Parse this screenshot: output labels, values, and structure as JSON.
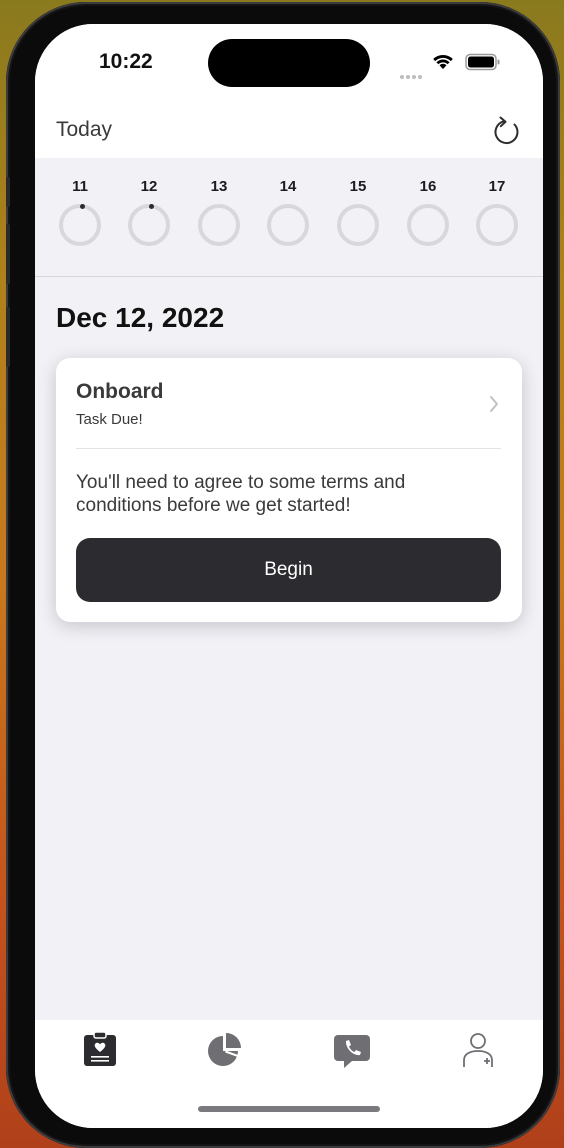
{
  "status_bar": {
    "time": "10:22"
  },
  "nav": {
    "title": "Today"
  },
  "week": {
    "days": [
      {
        "label": "11",
        "has_event": true
      },
      {
        "label": "12",
        "has_event": true
      },
      {
        "label": "13",
        "has_event": false
      },
      {
        "label": "14",
        "has_event": false
      },
      {
        "label": "15",
        "has_event": false
      },
      {
        "label": "16",
        "has_event": false
      },
      {
        "label": "17",
        "has_event": false
      }
    ]
  },
  "date_heading": "Dec 12, 2022",
  "task_card": {
    "title": "Onboard",
    "subtitle": "Task Due!",
    "body": "You'll need to agree to some terms and conditions before we get started!",
    "button_label": "Begin"
  },
  "tab_bar": {
    "tabs": [
      {
        "icon": "clipboard-heart-icon",
        "selected": true
      },
      {
        "icon": "pie-chart-icon",
        "selected": false
      },
      {
        "icon": "phone-bubble-icon",
        "selected": false
      },
      {
        "icon": "person-add-icon",
        "selected": false
      }
    ]
  },
  "colors": {
    "accent_dark": "#2c2c30",
    "background": "#f1f1f6",
    "ring": "#d8d8dc"
  }
}
